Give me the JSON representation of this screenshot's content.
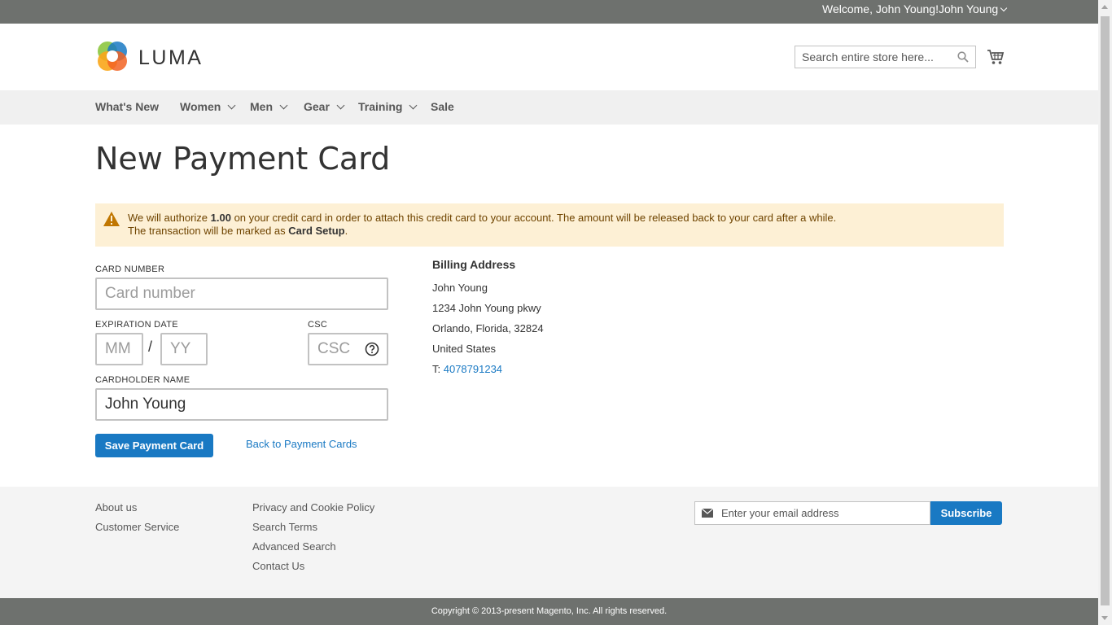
{
  "top_bar": {
    "welcome": "Welcome, John Young!",
    "account_name": "John Young"
  },
  "header": {
    "logo_text": "LUMA",
    "search_placeholder": "Search entire store here...",
    "logo_colors": [
      "#f26322",
      "#faa61a",
      "#8dc63f",
      "#1979c3"
    ]
  },
  "nav": {
    "items": [
      {
        "label": "What's New"
      },
      {
        "label": "Women"
      },
      {
        "label": "Men"
      },
      {
        "label": "Gear"
      },
      {
        "label": "Training"
      },
      {
        "label": "Sale"
      }
    ]
  },
  "page_title": "New Payment Card",
  "notice": {
    "part1": "We will authorize ",
    "amount": "1.00",
    "part2": " on your credit card in order to attach this credit card to your account. The amount will be released back to your card after a while.",
    "part3": "The transaction will be marked as ",
    "mark": "Card Setup",
    "part4": "."
  },
  "form": {
    "card_number_label": "CARD NUMBER",
    "card_number_placeholder": "Card number",
    "expiration_label": "EXPIRATION DATE",
    "month_placeholder": "MM",
    "year_placeholder": "YY",
    "slash": "/",
    "csc_label": "CSC",
    "csc_placeholder": "CSC",
    "cardholder_label": "CARDHOLDER NAME",
    "cardholder_value": "John Young",
    "save_label": "Save Payment Card",
    "back_label": "Back to Payment Cards"
  },
  "billing": {
    "title": "Billing Address",
    "name": "John Young",
    "street": "1234 John Young pkwy",
    "city_line": "Orlando, Florida, 32824",
    "country": "United States",
    "phone_prefix": "T: ",
    "phone": "4078791234"
  },
  "footer": {
    "col1": [
      "About us",
      "Customer Service"
    ],
    "col2": [
      "Privacy and Cookie Policy",
      "Search Terms",
      "Advanced Search",
      "Contact Us"
    ],
    "newsletter_placeholder": "Enter your email address",
    "subscribe_label": "Subscribe",
    "copyright": "Copyright © 2013-present Magento, Inc. All rights reserved."
  },
  "colors": {
    "primary": "#1979c3",
    "top_bar": "#6e716e",
    "notice_bg": "#fdf0d5"
  }
}
